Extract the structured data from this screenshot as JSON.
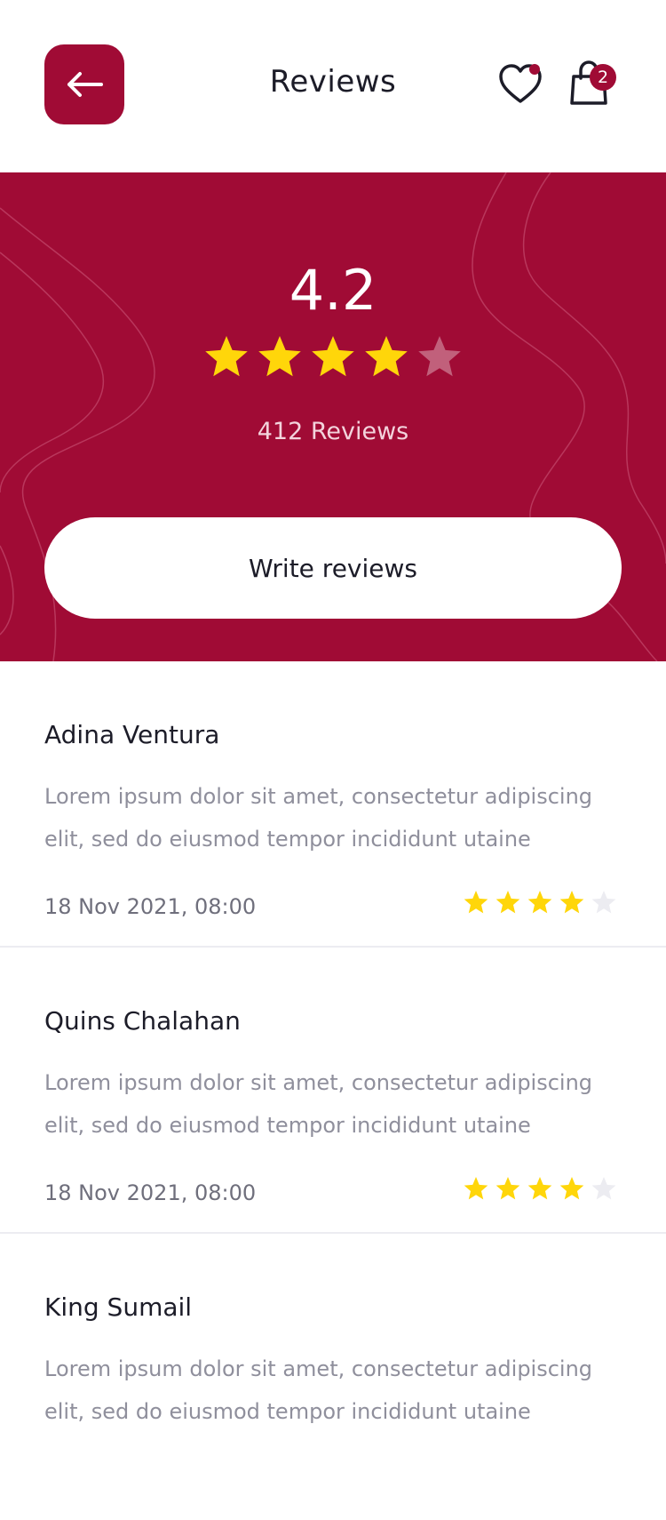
{
  "header": {
    "title": "Reviews",
    "cart_count": "2"
  },
  "summary": {
    "rating": "4.2",
    "rating_value": 4.2,
    "stars_filled": 4,
    "stars_total": 5,
    "review_count_label": "412 Reviews",
    "write_button_label": "Write reviews"
  },
  "colors": {
    "brand": "#a00b35",
    "star": "#ffd60a",
    "star_empty_light": "#ececf1"
  },
  "reviews": [
    {
      "name": "Adina Ventura",
      "text": "Lorem ipsum dolor sit amet, consectetur adipiscing elit, sed do eiusmod tempor incididunt utaine",
      "date": "18 Nov 2021, 08:00",
      "stars": 4
    },
    {
      "name": "Quins Chalahan",
      "text": "Lorem ipsum dolor sit amet, consectetur adipiscing elit, sed do eiusmod tempor incididunt utaine",
      "date": "18 Nov 2021, 08:00",
      "stars": 4
    },
    {
      "name": "King Sumail",
      "text": "Lorem ipsum dolor sit amet, consectetur adipiscing elit, sed do eiusmod tempor incididunt utaine",
      "date": "",
      "stars": 0
    }
  ]
}
